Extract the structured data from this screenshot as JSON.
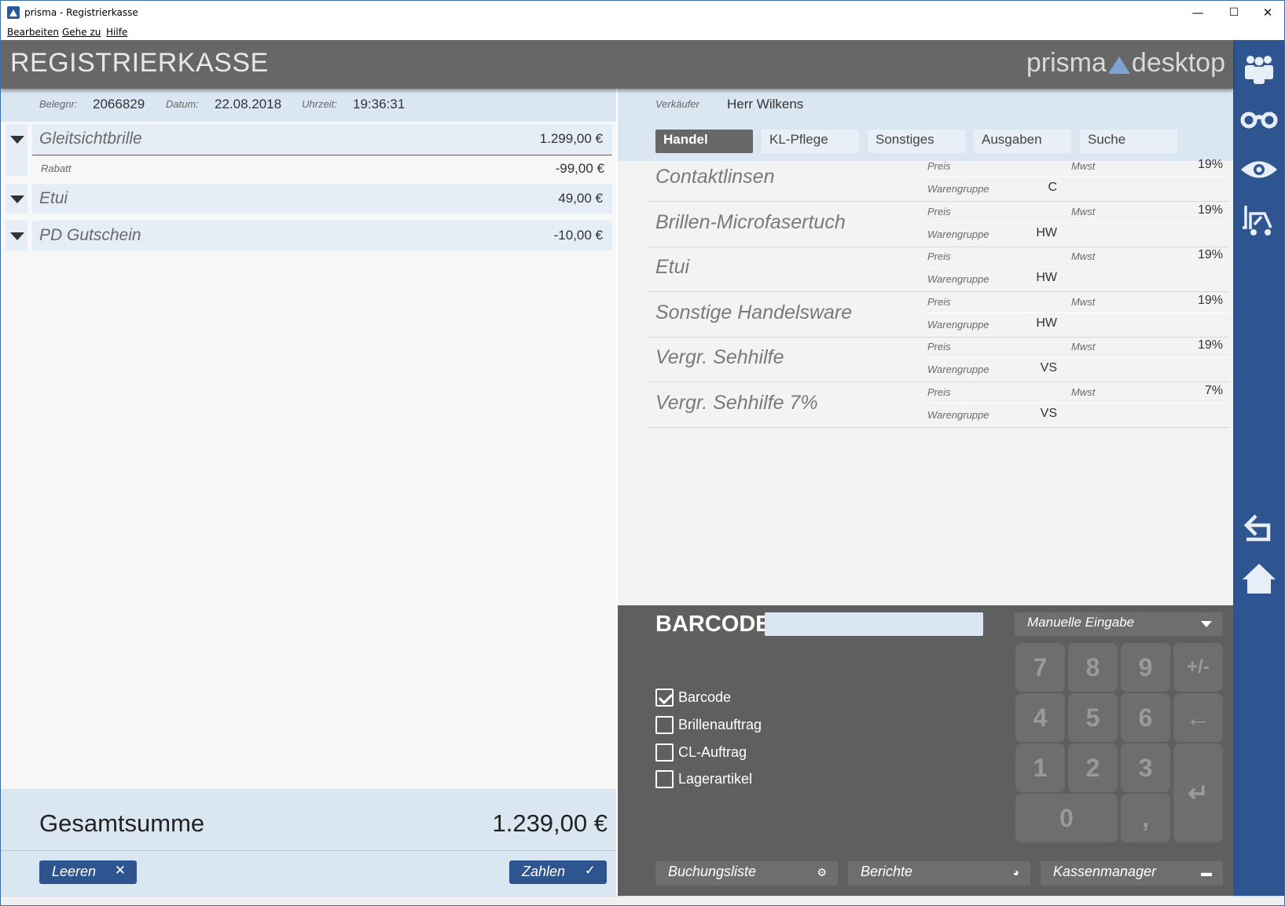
{
  "window": {
    "title": "prisma - Registrierkasse",
    "minimize": "—",
    "maximize": "☐",
    "close": "✕"
  },
  "menu": {
    "edit": "Bearbeiten",
    "goto": "Gehe zu",
    "help": "Hilfe"
  },
  "header": {
    "title": "REGISTRIERKASSE",
    "brand_left": "prisma",
    "brand_right": "desktop"
  },
  "sidebar": {
    "icons": [
      "customers-icon",
      "glasses-icon",
      "eye-icon",
      "forklift-icon",
      "back-arrow-icon",
      "home-icon"
    ]
  },
  "receipt": {
    "belegnr_label": "Belegnr:",
    "belegnr": "2066829",
    "datum_label": "Datum:",
    "datum": "22.08.2018",
    "uhrzeit_label": "Uhrzeit:",
    "uhrzeit": "19:36:31",
    "items": [
      {
        "name": "Gleitsichtbrille",
        "price": "1.299,00 €",
        "sub_label": "Rabatt",
        "sub_value": "-99,00 €"
      },
      {
        "name": "Etui",
        "price": "49,00 €"
      },
      {
        "name": "PD Gutschein",
        "price": "-10,00 €"
      }
    ],
    "total_label": "Gesamtsumme",
    "total_value": "1.239,00 €",
    "clear_button": "Leeren",
    "pay_button": "Zahlen"
  },
  "seller": {
    "label": "Verkäufer",
    "name": "Herr Wilkens"
  },
  "tabs": [
    {
      "label": "Handel",
      "active": true
    },
    {
      "label": "KL-Pflege",
      "active": false
    },
    {
      "label": "Sonstiges",
      "active": false
    },
    {
      "label": "Ausgaben",
      "active": false
    },
    {
      "label": "Suche",
      "active": false
    }
  ],
  "products": [
    {
      "name": "Contaktlinsen",
      "preis_label": "Preis",
      "mwst_label": "Mwst",
      "mwst": "19%",
      "wg_label": "Warengruppe",
      "wg": "C"
    },
    {
      "name": "Brillen-Microfasertuch",
      "preis_label": "Preis",
      "mwst_label": "Mwst",
      "mwst": "19%",
      "wg_label": "Warengruppe",
      "wg": "HW"
    },
    {
      "name": "Etui",
      "preis_label": "Preis",
      "mwst_label": "Mwst",
      "mwst": "19%",
      "wg_label": "Warengruppe",
      "wg": "HW"
    },
    {
      "name": "Sonstige Handelsware",
      "preis_label": "Preis",
      "mwst_label": "Mwst",
      "mwst": "19%",
      "wg_label": "Warengruppe",
      "wg": "HW"
    },
    {
      "name": "Vergr. Sehhilfe",
      "preis_label": "Preis",
      "mwst_label": "Mwst",
      "mwst": "19%",
      "wg_label": "Warengruppe",
      "wg": "VS"
    },
    {
      "name": "Vergr. Sehhilfe 7%",
      "preis_label": "Preis",
      "mwst_label": "Mwst",
      "mwst": "7%",
      "wg_label": "Warengruppe",
      "wg": "VS"
    }
  ],
  "barcode": {
    "label": "BARCODE",
    "input_value": "",
    "mode": "Manuelle Eingabe",
    "checkboxes": [
      {
        "label": "Barcode",
        "checked": true
      },
      {
        "label": "Brillenauftrag",
        "checked": false
      },
      {
        "label": "CL-Auftrag",
        "checked": false
      },
      {
        "label": "Lagerartikel",
        "checked": false
      }
    ]
  },
  "keypad": {
    "k7": "7",
    "k8": "8",
    "k9": "9",
    "sign": "+/-",
    "k4": "4",
    "k5": "5",
    "k6": "6",
    "backspace": "←",
    "k1": "1",
    "k2": "2",
    "k3": "3",
    "enter": "↵",
    "k0": "0",
    "comma": ","
  },
  "bottom": {
    "buchungsliste": "Buchungsliste",
    "berichte": "Berichte",
    "kassenmanager": "Kassenmanager"
  },
  "colors": {
    "accent": "#2f5591",
    "header": "#676767",
    "panel": "#dbe6f3",
    "keypad": "#5f5f5f"
  }
}
